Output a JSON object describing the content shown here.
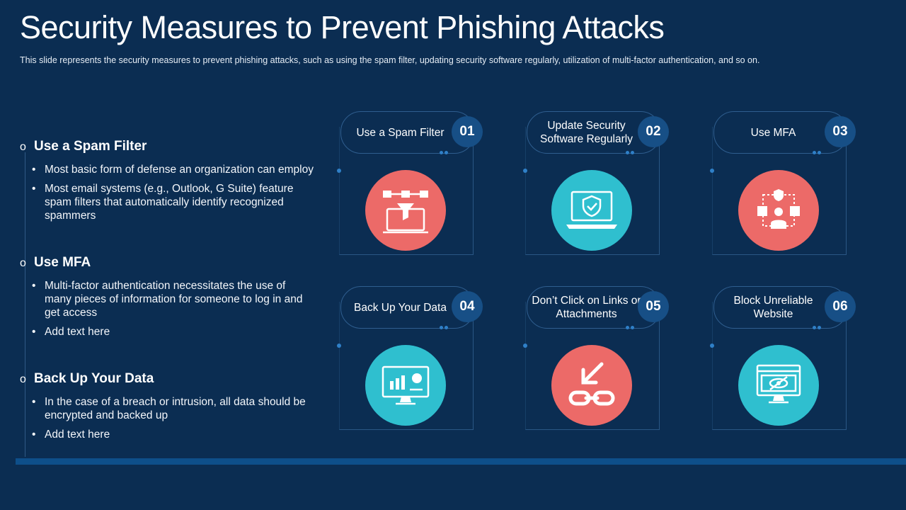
{
  "title": "Security Measures to Prevent Phishing Attacks",
  "subtitle": "This slide represents the security measures to prevent  phishing attacks, such as using the spam filter, updating security software regularly, utilization of multi-factor authentication, and so on.",
  "sections": [
    {
      "marker": "o",
      "heading": "Use a Spam Filter",
      "bullets": [
        "Most basic form of defense an organization can employ",
        "Most email systems (e.g., Outlook, G Suite) feature spam filters that automatically identify recognized spammers"
      ]
    },
    {
      "marker": "o",
      "heading": "Use MFA",
      "bullets": [
        "Multi-factor authentication necessitates the use of many pieces of information for someone to log in and get access",
        "Add text here"
      ]
    },
    {
      "marker": "o",
      "heading": "Back Up Your Data",
      "bullets": [
        "In the case of a breach or intrusion, all data should be encrypted and backed up",
        "Add text here"
      ]
    }
  ],
  "cards": [
    {
      "label": "Use a Spam Filter",
      "number": "01",
      "icon": "spam-filter-icon",
      "color": "#ec6a68"
    },
    {
      "label": "Update Security Software Regularly",
      "number": "02",
      "icon": "security-laptop-icon",
      "color": "#2fbfcf"
    },
    {
      "label": "Use MFA",
      "number": "03",
      "icon": "mfa-user-icon",
      "color": "#ec6a68"
    },
    {
      "label": "Back Up Your Data",
      "number": "04",
      "icon": "monitor-chart-icon",
      "color": "#2fbfcf"
    },
    {
      "label": "Don’t Click on Links or Attachments",
      "number": "05",
      "icon": "broken-link-icon",
      "color": "#ec6a68"
    },
    {
      "label": "Block Unreliable Website",
      "number": "06",
      "icon": "blocked-website-icon",
      "color": "#2fbfcf"
    }
  ]
}
